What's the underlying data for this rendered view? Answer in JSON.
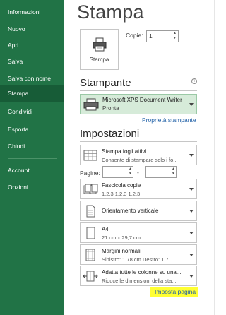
{
  "sidebar": {
    "items": [
      {
        "label": "Informazioni"
      },
      {
        "label": "Nuovo"
      },
      {
        "label": "Apri"
      },
      {
        "label": "Salva"
      },
      {
        "label": "Salva con nome"
      },
      {
        "label": "Stampa"
      },
      {
        "label": "Condividi"
      },
      {
        "label": "Esporta"
      },
      {
        "label": "Chiudi"
      },
      {
        "label": "Account"
      },
      {
        "label": "Opzioni"
      }
    ],
    "active_index": 5,
    "bg_color": "#217346"
  },
  "main": {
    "title": "Stampa",
    "print_button_label": "Stampa",
    "copies_label": "Copie:",
    "copies_value": "1",
    "printer_heading": "Stampante",
    "printer": {
      "name": "Microsoft XPS Document Writer",
      "status": "Pronta"
    },
    "printer_properties_link": "Proprietà stampante",
    "settings_heading": "Impostazioni",
    "settings": {
      "scope": {
        "line1": "Stampa fogli attivi",
        "line2": "Consente di stampare solo i fo..."
      },
      "pages_label": "Pagine:",
      "pages_dash": "-",
      "collate": {
        "line1": "Fascicola copie",
        "line2": "1,2,3    1,2,3    1,2,3"
      },
      "orientation": {
        "line1": "Orientamento verticale"
      },
      "paper": {
        "line1": "A4",
        "line2": "21 cm x 29,7 cm"
      },
      "margins": {
        "line1": "Margini normali",
        "line2": "Sinistro: 1,78 cm    Destro: 1,7..."
      },
      "scaling": {
        "line1": "Adatta tutte le colonne su una...",
        "line2": "Riduce le dimensioni della sta..."
      }
    },
    "page_setup_link": "Imposta pagina",
    "highlight_color": "#ffff33",
    "accent_color": "#217346"
  }
}
